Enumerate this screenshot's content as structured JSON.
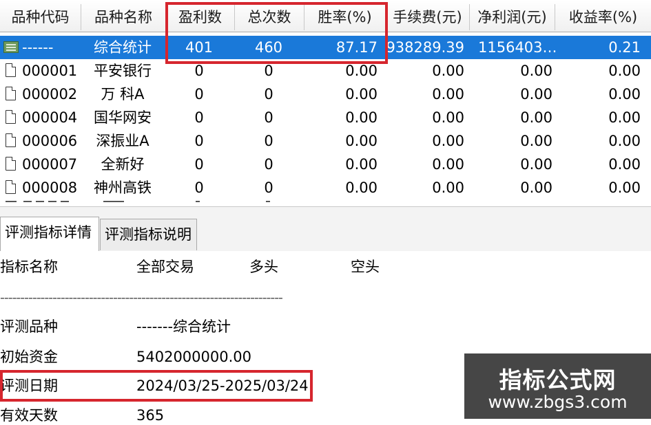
{
  "grid": {
    "columns": [
      "品种代码",
      "品种名称",
      "盈利数",
      "总次数",
      "胜率(%)",
      "手续费(元)",
      "净利润(元)",
      "收益率(%)"
    ],
    "summary_row": {
      "code": "------",
      "name": "综合统计",
      "wins": "401",
      "total": "460",
      "win_rate": "87.17",
      "fee": "938289.39",
      "net_profit": "1156403…",
      "return_rate": "0.21"
    },
    "rows": [
      {
        "code": "000001",
        "name": "平安银行",
        "wins": "0",
        "total": "0",
        "win_rate": "0.00",
        "fee": "0.00",
        "net_profit": "0.00",
        "return_rate": "0.00"
      },
      {
        "code": "000002",
        "name": "万 科A",
        "wins": "0",
        "total": "0",
        "win_rate": "0.00",
        "fee": "0.00",
        "net_profit": "0.00",
        "return_rate": "0.00"
      },
      {
        "code": "000004",
        "name": "国华网安",
        "wins": "0",
        "total": "0",
        "win_rate": "0.00",
        "fee": "0.00",
        "net_profit": "0.00",
        "return_rate": "0.00"
      },
      {
        "code": "000006",
        "name": "深振业A",
        "wins": "0",
        "total": "0",
        "win_rate": "0.00",
        "fee": "0.00",
        "net_profit": "0.00",
        "return_rate": "0.00"
      },
      {
        "code": "000007",
        "name": "全新好",
        "wins": "0",
        "total": "0",
        "win_rate": "0.00",
        "fee": "0.00",
        "net_profit": "0.00",
        "return_rate": "0.00"
      },
      {
        "code": "000008",
        "name": "神州高铁",
        "wins": "0",
        "total": "0",
        "win_rate": "0.00",
        "fee": "0.00",
        "net_profit": "0.00",
        "return_rate": "0.00"
      }
    ]
  },
  "tabs": [
    {
      "label": "评测指标详情",
      "active": true
    },
    {
      "label": "评测指标说明",
      "active": false
    }
  ],
  "details": {
    "header": {
      "label": "指标名称",
      "all": "全部交易",
      "long": "多头",
      "short": "空头"
    },
    "separator": "----------------------------------------------------------------------",
    "items": [
      {
        "label": "评测品种",
        "value": "-------综合统计"
      },
      {
        "label": "初始资金",
        "value": "5402000000.00"
      },
      {
        "label": "评测日期",
        "value": "2024/03/25-2025/03/24"
      },
      {
        "label": "有效天数",
        "value": "365"
      }
    ]
  },
  "watermark": {
    "title": "指标公式网",
    "url": "www.zbgs3.com"
  },
  "colors": {
    "selection": "#1a79d9",
    "highlight": "#d6262e"
  }
}
